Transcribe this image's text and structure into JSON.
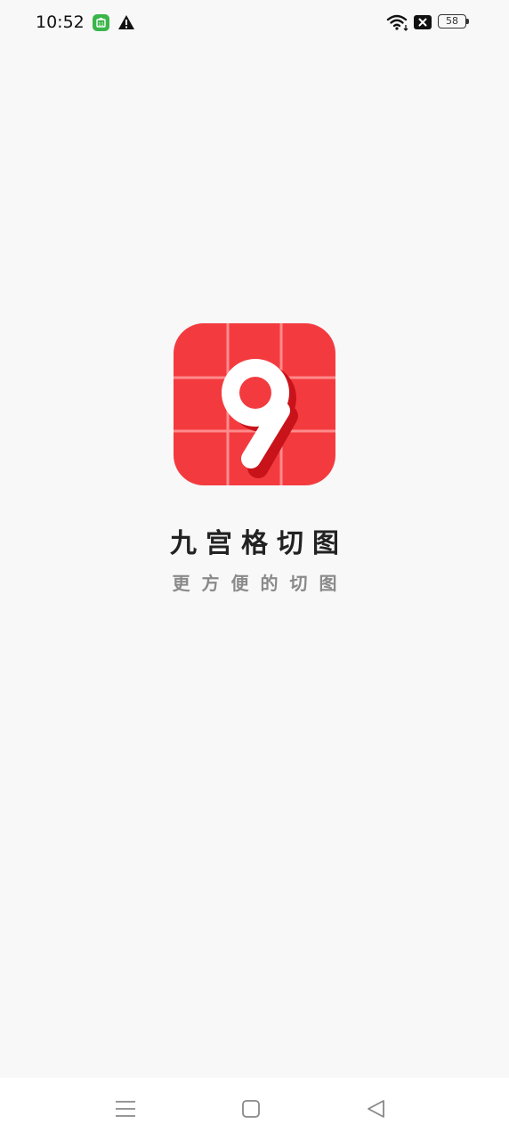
{
  "status_bar": {
    "time": "10:52",
    "battery_level": "58",
    "icons": [
      "notification-app-icon",
      "warning-icon",
      "wifi-icon",
      "x-box-icon",
      "battery-icon"
    ]
  },
  "splash": {
    "app_name": "九宫格切图",
    "slogan": "更方便的切图",
    "logo": {
      "glyph": "9",
      "background_color": "#f33b3f",
      "grid_color": "#ff9a9a",
      "glyph_color": "#ffffff",
      "shadow_color": "#c9131b"
    }
  },
  "nav_bar": {
    "buttons": [
      "menu-icon",
      "home-icon",
      "back-icon"
    ]
  }
}
